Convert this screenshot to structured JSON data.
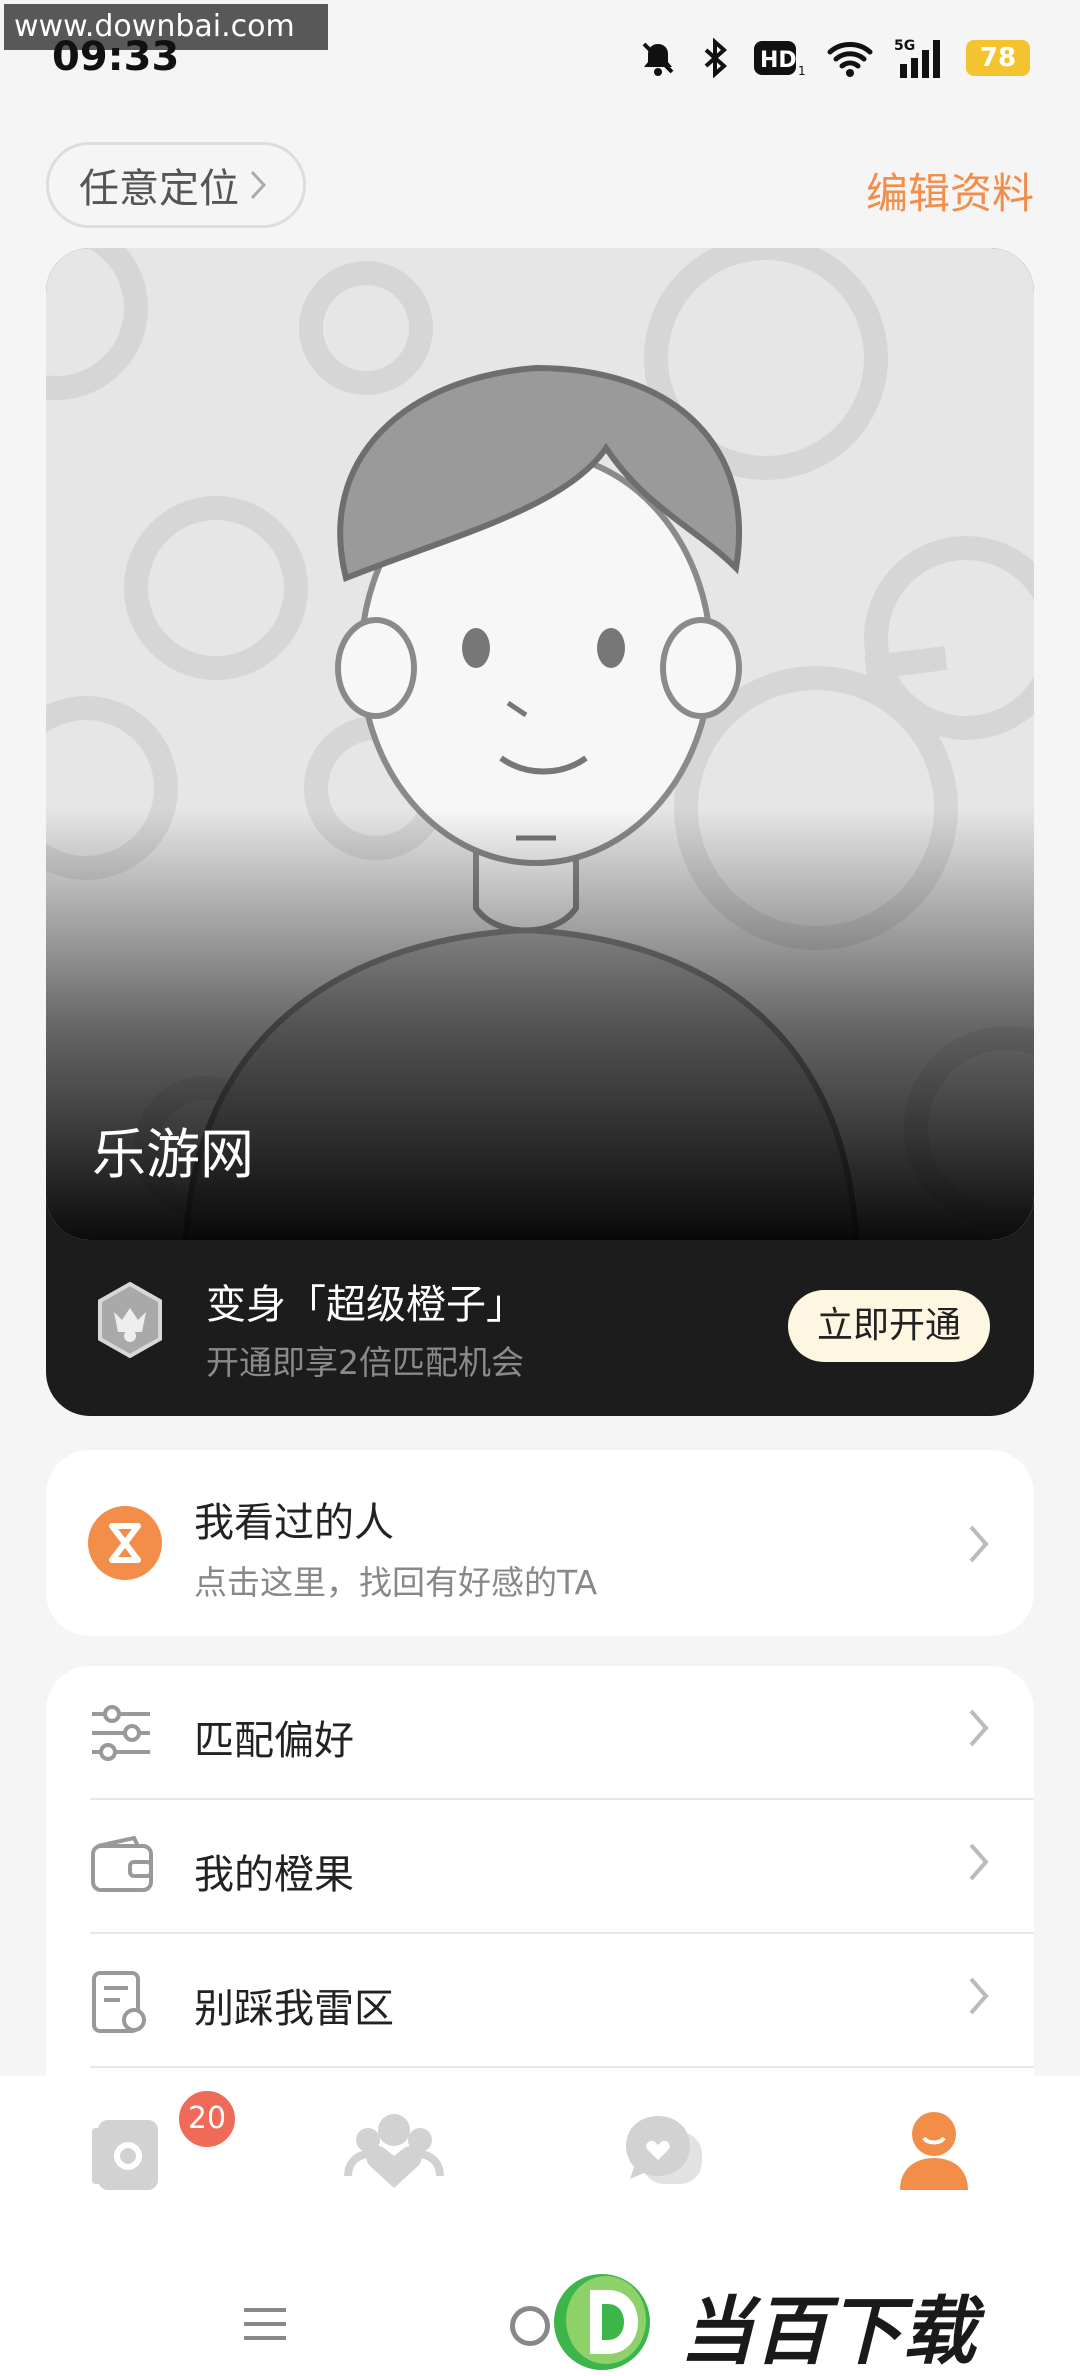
{
  "watermark": "www.downbai.com",
  "status": {
    "time": "09:33",
    "battery": "78"
  },
  "top": {
    "location_label": "任意定位",
    "edit_label": "编辑资料"
  },
  "profile": {
    "name": "乐游网",
    "vip_title": "变身「超级橙子」",
    "vip_subtitle": "开通即享2倍匹配机会",
    "vip_button": "立即开通"
  },
  "visited": {
    "title": "我看过的人",
    "subtitle": "点击这里，找回有好感的TA"
  },
  "menu": {
    "items": [
      {
        "label": "匹配偏好",
        "icon": "sliders-icon"
      },
      {
        "label": "我的橙果",
        "icon": "wallet-icon"
      },
      {
        "label": "别踩我雷区",
        "icon": "document-icon"
      }
    ]
  },
  "tabs": {
    "items": [
      {
        "icon": "camera-icon",
        "badge": "20"
      },
      {
        "icon": "people-heart-icon"
      },
      {
        "icon": "chat-heart-icon"
      },
      {
        "icon": "user-icon",
        "active": true
      }
    ]
  },
  "brand": {
    "text": "当百下载"
  },
  "colors": {
    "accent": "#f28d4a",
    "badge": "#f06a5a",
    "vip_button_bg": "#fdf6e0"
  }
}
